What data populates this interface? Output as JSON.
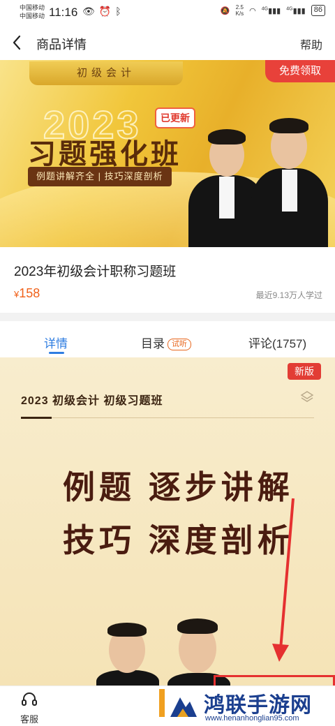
{
  "status_bar": {
    "carrier_1": "中国移动",
    "carrier_2": "中国移动",
    "time": "11:16",
    "speed_value": "2.5",
    "speed_unit": "K/s",
    "signal_label_1": "4G",
    "signal_label_2": "4G",
    "battery": "86"
  },
  "nav": {
    "title": "商品详情",
    "help": "帮助"
  },
  "banner": {
    "plaque": "初级会计",
    "free_badge": "免费领取",
    "year": "2023",
    "updated_tag": "已更新",
    "title": "习题强化班",
    "subtitle": "例题讲解齐全 | 技巧深度剖析"
  },
  "product": {
    "title": "2023年初级会计职称习题班",
    "currency": "¥",
    "price": "158",
    "learners": "最近9.13万人学过"
  },
  "tabs": {
    "details": "详情",
    "catalog": "目录",
    "trial": "试听",
    "reviews": "评论(1757)"
  },
  "poster": {
    "new_badge": "新版",
    "heading": "2023 初级会计 初级习题班",
    "slogan_line_1": "例题 逐步讲解",
    "slogan_line_2": "技巧 深度剖析"
  },
  "bottom_bar": {
    "customer_service": "客服"
  },
  "watermark": {
    "title": "鸿联手游网",
    "url": "www.henanhonglian95.com"
  },
  "colors": {
    "accent_blue": "#2f7de1",
    "price_orange": "#f0611a",
    "badge_red": "#e23d35",
    "banner_gold": "#f1c63a"
  }
}
